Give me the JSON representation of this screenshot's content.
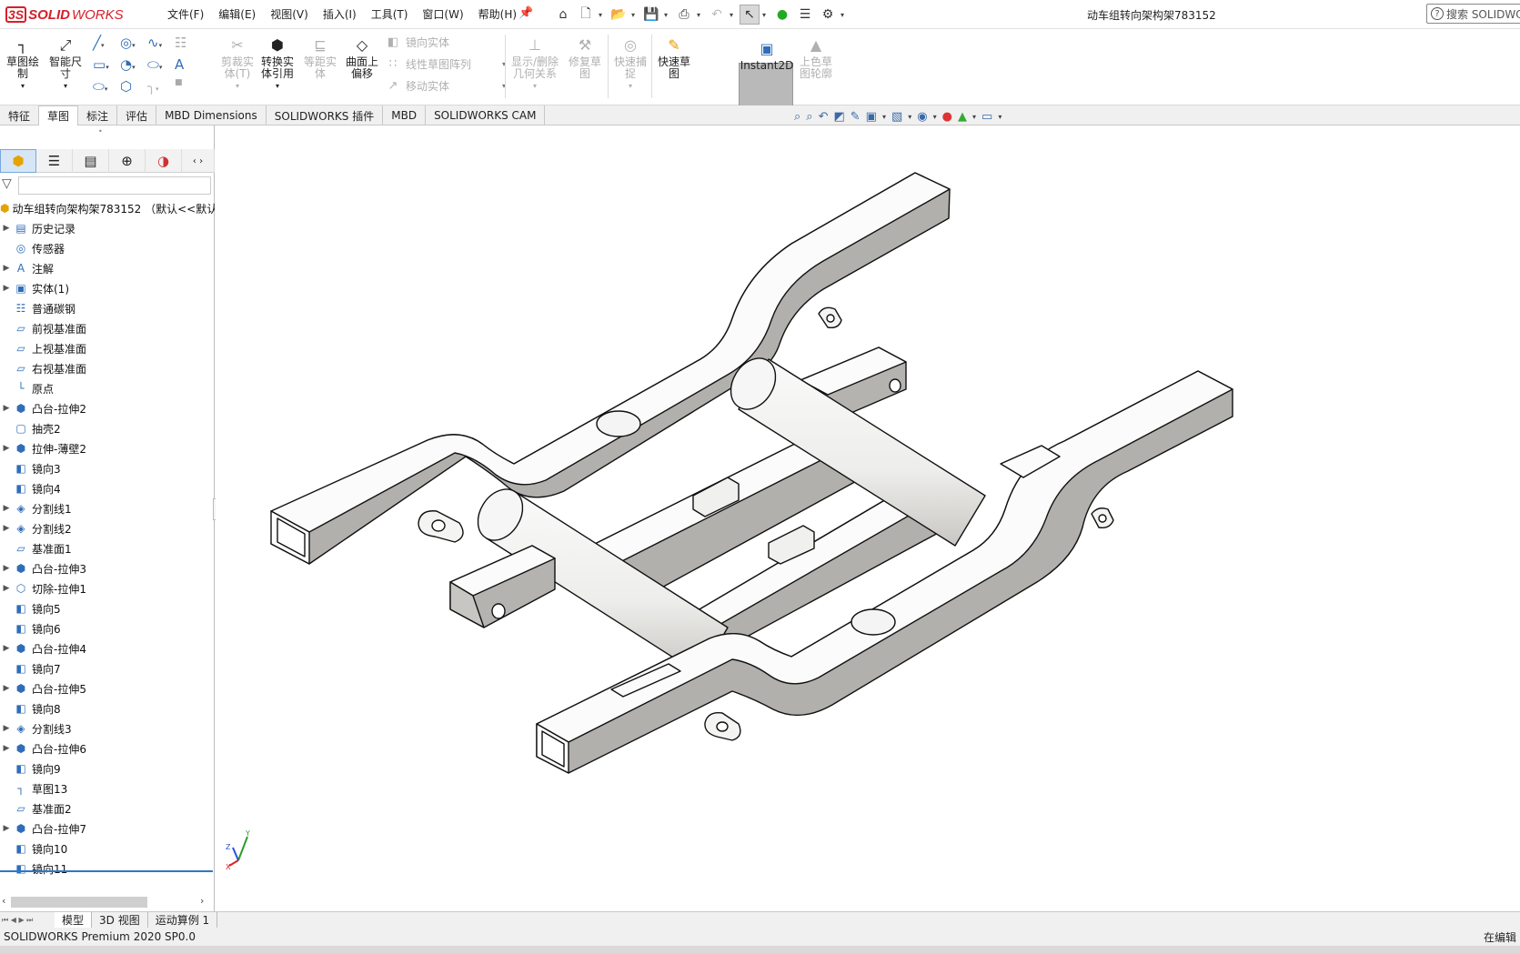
{
  "app": {
    "logo_ds": "3S",
    "logo_solid": "SOLID",
    "logo_works": "WORKS",
    "document_title": "动车组转向架构架783152",
    "search_placeholder": "搜索 SOLIDWO"
  },
  "menu": [
    "文件(F)",
    "编辑(E)",
    "视图(V)",
    "插入(I)",
    "工具(T)",
    "窗口(W)",
    "帮助(H)"
  ],
  "quick_access_icons": [
    "home-icon",
    "new-document-icon",
    "open-icon",
    "save-icon",
    "print-icon",
    "undo-icon",
    "select-cursor-icon",
    "traffic-light-icon",
    "file-properties-icon",
    "options-gear-icon"
  ],
  "ribbon": {
    "sketch": "草图绘\n制",
    "smart_dim": "智能尺\n寸",
    "trim": "剪裁实\n体(T)",
    "convert": "转换实\n体引用",
    "offset": "等距实\n体",
    "surface_offset": "曲面上\n偏移",
    "mirror": "镜向实体",
    "linear_pattern": "线性草图阵列",
    "move": "移动实体",
    "show_relations": "显示/删除\n几何关系",
    "repair": "修复草\n图",
    "quick_snap": "快速捕\n捉",
    "rapid_sketch": "快速草\n图",
    "instant2d": "Instant2D",
    "shaded_contour": "上色草\n图轮廓"
  },
  "command_tabs": [
    "特征",
    "草图",
    "标注",
    "评估",
    "MBD Dimensions",
    "SOLIDWORKS 插件",
    "MBD",
    "SOLIDWORKS CAM"
  ],
  "active_command_tab": "草图",
  "feature_tree": {
    "root": "动车组转向架构架783152 （默认<<默认",
    "items": [
      {
        "label": "历史记录",
        "icon": "history-folder-icon",
        "expand": true
      },
      {
        "label": "传感器",
        "icon": "sensor-icon",
        "expand": false
      },
      {
        "label": "注解",
        "icon": "annotation-icon",
        "expand": true
      },
      {
        "label": "实体(1)",
        "icon": "solid-bodies-icon",
        "expand": true
      },
      {
        "label": "普通碳钢",
        "icon": "material-icon",
        "expand": false
      },
      {
        "label": "前视基准面",
        "icon": "plane-icon",
        "expand": false
      },
      {
        "label": "上视基准面",
        "icon": "plane-icon",
        "expand": false
      },
      {
        "label": "右视基准面",
        "icon": "plane-icon",
        "expand": false
      },
      {
        "label": "原点",
        "icon": "origin-icon",
        "expand": false
      },
      {
        "label": "凸台-拉伸2",
        "icon": "extrude-boss-icon",
        "expand": true
      },
      {
        "label": "抽壳2",
        "icon": "shell-icon",
        "expand": false
      },
      {
        "label": "拉伸-薄壁2",
        "icon": "thin-extrude-icon",
        "expand": true
      },
      {
        "label": "镜向3",
        "icon": "mirror-icon",
        "expand": false
      },
      {
        "label": "镜向4",
        "icon": "mirror-icon",
        "expand": false
      },
      {
        "label": "分割线1",
        "icon": "split-line-icon",
        "expand": true
      },
      {
        "label": "分割线2",
        "icon": "split-line-icon",
        "expand": true
      },
      {
        "label": "基准面1",
        "icon": "plane-icon",
        "expand": false
      },
      {
        "label": "凸台-拉伸3",
        "icon": "extrude-boss-icon",
        "expand": true
      },
      {
        "label": "切除-拉伸1",
        "icon": "extrude-cut-icon",
        "expand": true
      },
      {
        "label": "镜向5",
        "icon": "mirror-icon",
        "expand": false
      },
      {
        "label": "镜向6",
        "icon": "mirror-icon",
        "expand": false
      },
      {
        "label": "凸台-拉伸4",
        "icon": "extrude-boss-icon",
        "expand": true
      },
      {
        "label": "镜向7",
        "icon": "mirror-icon",
        "expand": false
      },
      {
        "label": "凸台-拉伸5",
        "icon": "extrude-boss-icon",
        "expand": true
      },
      {
        "label": "镜向8",
        "icon": "mirror-icon",
        "expand": false
      },
      {
        "label": "分割线3",
        "icon": "split-line-icon",
        "expand": true
      },
      {
        "label": "凸台-拉伸6",
        "icon": "extrude-boss-icon",
        "expand": true
      },
      {
        "label": "镜向9",
        "icon": "mirror-icon",
        "expand": false
      },
      {
        "label": "草图13",
        "icon": "sketch-icon",
        "expand": false
      },
      {
        "label": "基准面2",
        "icon": "plane-icon",
        "expand": false
      },
      {
        "label": "凸台-拉伸7",
        "icon": "extrude-boss-icon",
        "expand": true
      },
      {
        "label": "镜向10",
        "icon": "mirror-icon",
        "expand": false
      },
      {
        "label": "镜向11",
        "icon": "mirror-icon",
        "expand": false
      }
    ]
  },
  "bottom_tabs": [
    "模型",
    "3D 视图",
    "运动算例 1"
  ],
  "active_bottom_tab": "模型",
  "status": {
    "left": "SOLIDWORKS Premium 2020 SP0.0",
    "right": "在编辑"
  },
  "triad": {
    "x": "X",
    "y": "Y",
    "z": "Z"
  },
  "colors": {
    "brand_red": "#d6202a",
    "accent_blue": "#2d79c7",
    "model_top": "#ffffff",
    "model_side": "#b4b2ae",
    "model_shadow": "#8f8d89"
  }
}
